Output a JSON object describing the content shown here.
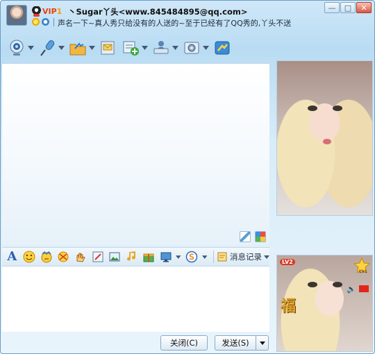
{
  "window": {
    "vip_label": "VIP",
    "vip_level": "1",
    "contact_title": "丶Sugar丫头<www.845484895@qq.com>",
    "signature": "声名一下~真人秀只给没有的人送的~至于已经有了QQ秀的,丫头不送"
  },
  "toolbar": {
    "items": [
      "video-call",
      "voice-call",
      "send-file",
      "send-email",
      "add-application",
      "remote-assistance",
      "settings",
      "share"
    ]
  },
  "input_toolbar": {
    "font_icon": "A",
    "message_history_label": "消息记录"
  },
  "input": {
    "value": ""
  },
  "buttons": {
    "close_label": "关闭(C)",
    "send_label": "发送(S)"
  },
  "show_panel": {
    "level_badge": "LV2",
    "level_star": "Lv1",
    "fu_char": "福"
  },
  "colors": {
    "accent": "#2b5db5",
    "vip_red": "#e8410f",
    "window_bg": "#d8ecf9"
  }
}
